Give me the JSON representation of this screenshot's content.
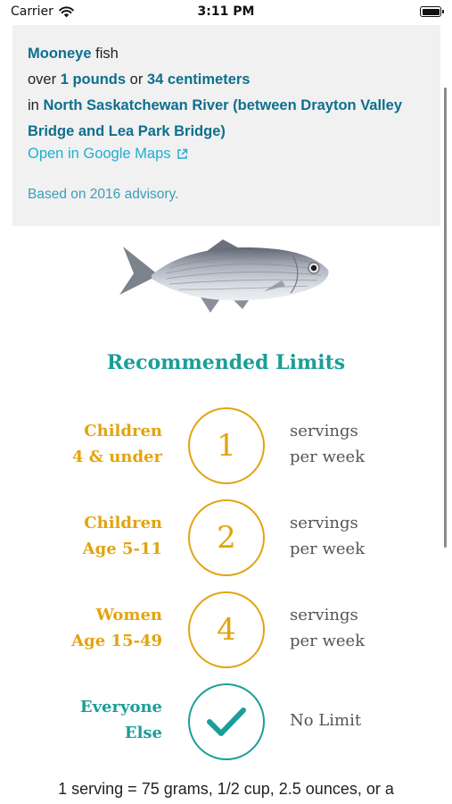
{
  "status_bar": {
    "carrier": "Carrier",
    "time": "3:11 PM"
  },
  "info": {
    "species": "Mooneye",
    "fish_word": "fish",
    "over_word": "over",
    "pounds": "1 pounds",
    "or_word": "or",
    "centimeters": "34 centimeters",
    "in_word": "in",
    "location": "North Saskatchewan River (between Drayton Valley Bridge and Lea Park Bridge)",
    "maps_link": "Open in Google Maps",
    "advisory": "Based on 2016 advisory."
  },
  "limits": {
    "title": "Recommended Limits",
    "rows": [
      {
        "label": "Children\n4 & under",
        "value": "1",
        "unit": "servings\nper week",
        "color": "#e2a40e"
      },
      {
        "label": "Children\nAge 5-11",
        "value": "2",
        "unit": "servings\nper week",
        "color": "#e2a40e"
      },
      {
        "label": "Women\nAge 15-49",
        "value": "4",
        "unit": "servings\nper week",
        "color": "#e2a40e"
      },
      {
        "label": "Everyone\nElse",
        "icon": "checkmark-icon",
        "unit": "No Limit",
        "color": "#1b9e98"
      }
    ]
  },
  "footer": "1 serving = 75 grams, 1/2 cup, 2.5 ounces, or a"
}
